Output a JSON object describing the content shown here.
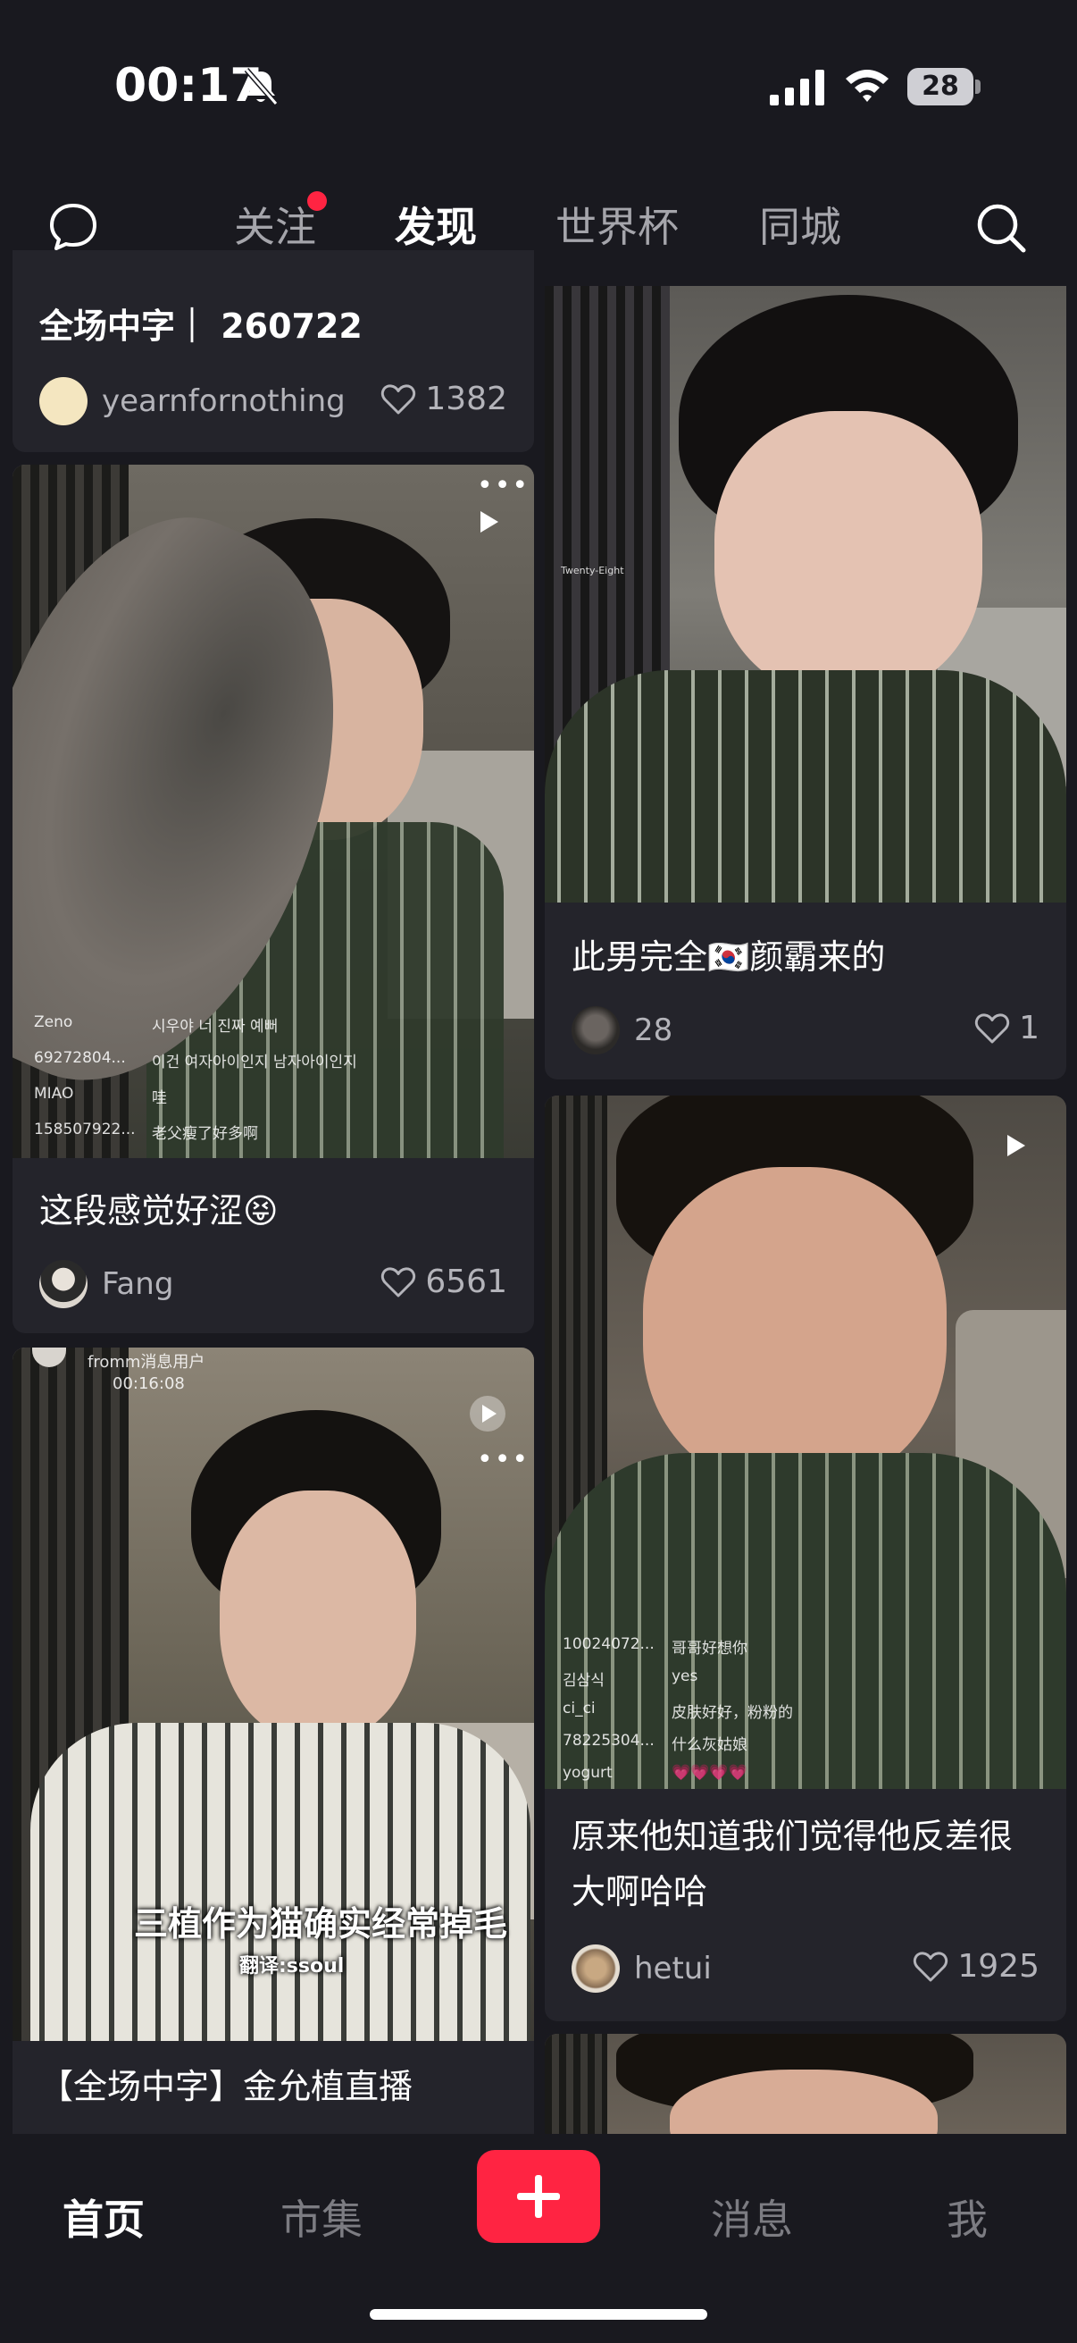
{
  "status_bar": {
    "time": "00:17",
    "battery": "28"
  },
  "top_nav": {
    "tabs": [
      {
        "label": "关注"
      },
      {
        "label": "发现"
      },
      {
        "label": "世界杯"
      },
      {
        "label": "同城"
      }
    ],
    "active_tab": "发现"
  },
  "feed": {
    "left": [
      {
        "title": "全场中字｜ 260722",
        "author": "yearnfornothing",
        "likes": "1382"
      },
      {
        "title": "这段感觉好涩😝",
        "author": "Fang",
        "likes": "6561",
        "comments": [
          {
            "user": "Zeno",
            "text": "시우야 너 진짜 예뻐"
          },
          {
            "user": "69272804...",
            "text": "이건 여자아이인지 남자아이인지"
          },
          {
            "user": "MIAO",
            "text": "哇"
          },
          {
            "user": "158507922...",
            "text": "老父瘦了好多啊"
          }
        ]
      },
      {
        "title": "【全场中字】金允植直播",
        "header_user": "fromm消息用户",
        "header_time": "00:16:08",
        "caption": "三植作为猫确实经常掉毛",
        "translator": "翻译:ssoul"
      }
    ],
    "right": [
      {
        "title": "此男完全🇰🇷颜霸来的",
        "author": "28",
        "likes": "1",
        "watermark": "Twenty-Eight"
      },
      {
        "title": "原来他知道我们觉得他反差很大啊哈哈",
        "author": "hetui",
        "likes": "1925",
        "comments": [
          {
            "user": "10024072...",
            "text": "哥哥好想你"
          },
          {
            "user": "김삼식",
            "text": "yes"
          },
          {
            "user": "ci_ci",
            "text": "皮肤好好，粉粉的"
          },
          {
            "user": "78225304...",
            "text": "什么灰姑娘"
          },
          {
            "user": "yogurt",
            "text": "💗💗💗💗"
          }
        ]
      }
    ]
  },
  "bottom_nav": {
    "items": [
      {
        "label": "首页"
      },
      {
        "label": "市集"
      },
      {
        "label": "消息"
      },
      {
        "label": "我"
      }
    ],
    "add_label": "+"
  },
  "colors": {
    "accent": "#ff2442",
    "background": "#19191f",
    "card": "#24242b"
  }
}
